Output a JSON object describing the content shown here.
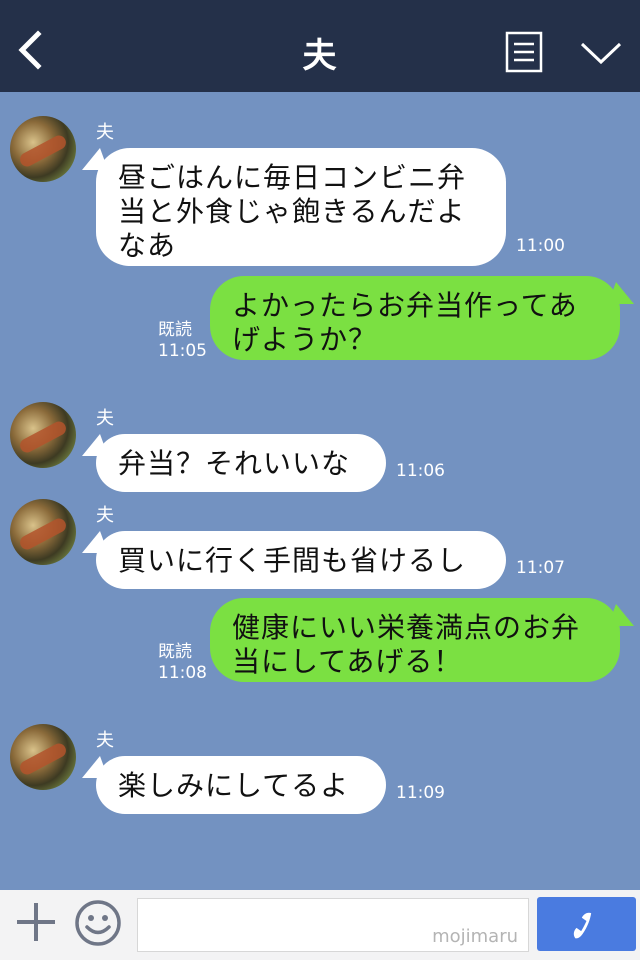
{
  "header": {
    "title": "夫"
  },
  "messages": [
    {
      "sender": "夫",
      "text": "昼ごはんに毎日コンビニ弁当と外食じゃ飽きるんだよなあ",
      "time": "11:00"
    },
    {
      "status": "既読",
      "text": "よかったらお弁当作ってあげようか？",
      "time": "11:05"
    },
    {
      "sender": "夫",
      "text": "弁当？それいいな",
      "time": "11:06"
    },
    {
      "sender": "夫",
      "text": "買いに行く手間も省けるし",
      "time": "11:07"
    },
    {
      "status": "既読",
      "text": "健康にいい栄養満点のお弁当にしてあげる！",
      "time": "11:08"
    },
    {
      "sender": "夫",
      "text": "楽しみにしてるよ",
      "time": "11:09"
    }
  ],
  "input": {
    "watermark": "mojimaru"
  },
  "colors": {
    "header_bg": "#243049",
    "chat_bg": "#7392c1",
    "outgoing_bubble": "#7be042",
    "call_button": "#4a7be0"
  },
  "icons": [
    "back-icon",
    "menu-icon",
    "chevron-down-icon",
    "plus-icon",
    "smile-icon",
    "phone-icon"
  ]
}
